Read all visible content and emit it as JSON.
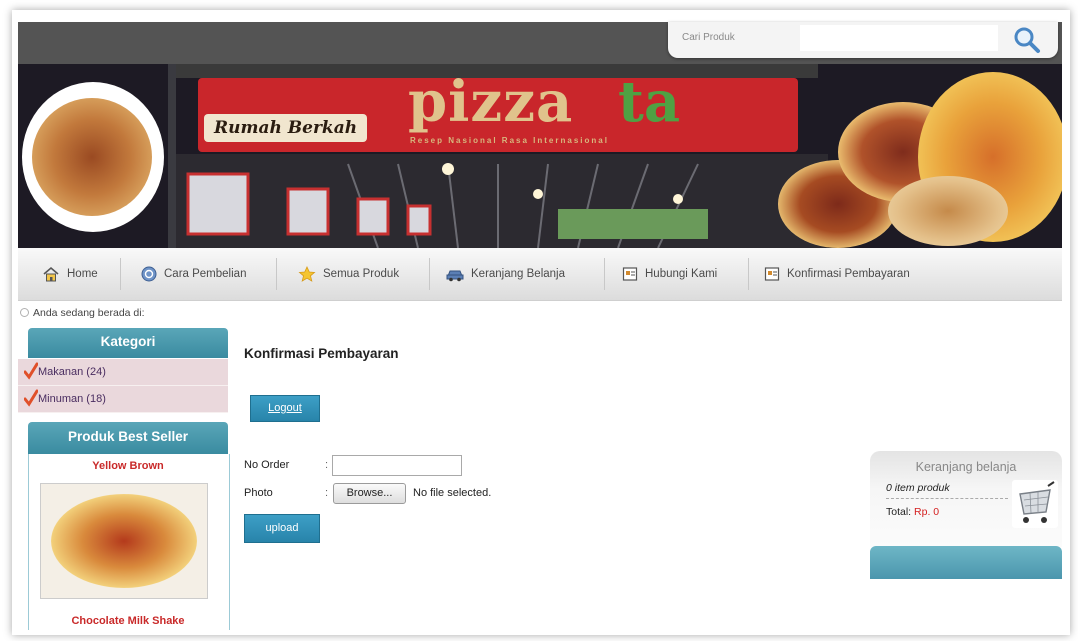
{
  "search": {
    "label": "Cari Produk",
    "value": ""
  },
  "banner": {
    "sign_left": "Rumah Berkah",
    "sign_pizza": "pizza",
    "sign_ta": "ta",
    "sign_sub": "Resep Nasional Rasa Internasional"
  },
  "nav": {
    "items": [
      {
        "label": "Home",
        "icon": "home-icon"
      },
      {
        "label": "Cara Pembelian",
        "icon": "help-icon"
      },
      {
        "label": "Semua Produk",
        "icon": "star-icon"
      },
      {
        "label": "Keranjang Belanja",
        "icon": "car-icon"
      },
      {
        "label": "Hubungi Kami",
        "icon": "contact-icon"
      },
      {
        "label": "Konfirmasi Pembayaran",
        "icon": "contact-icon"
      }
    ]
  },
  "breadcrumb": {
    "text": "Anda sedang berada di:"
  },
  "sidebar": {
    "kategori_title": "Kategori",
    "categories": [
      {
        "label": "Makanan (24)"
      },
      {
        "label": "Minuman (18)"
      }
    ],
    "bestseller_title": "Produk Best Seller",
    "products": [
      {
        "name": "Yellow Brown"
      },
      {
        "name": "Chocolate Milk Shake"
      }
    ]
  },
  "main": {
    "title": "Konfirmasi Pembayaran",
    "logout_label": "Logout",
    "form": {
      "order_label": "No Order",
      "photo_label": "Photo",
      "colon": ":",
      "order_value": "",
      "browse_label": "Browse...",
      "file_status": "No file selected.",
      "upload_label": "upload"
    }
  },
  "cart": {
    "title": "Keranjang belanja",
    "items_text": "0 item produk",
    "total_label": "Total:",
    "total_value": "Rp. 0"
  },
  "colors": {
    "accent": "#3a8ba0",
    "button": "#2884aa",
    "product_name": "#c92a2a",
    "price": "#d42020"
  }
}
